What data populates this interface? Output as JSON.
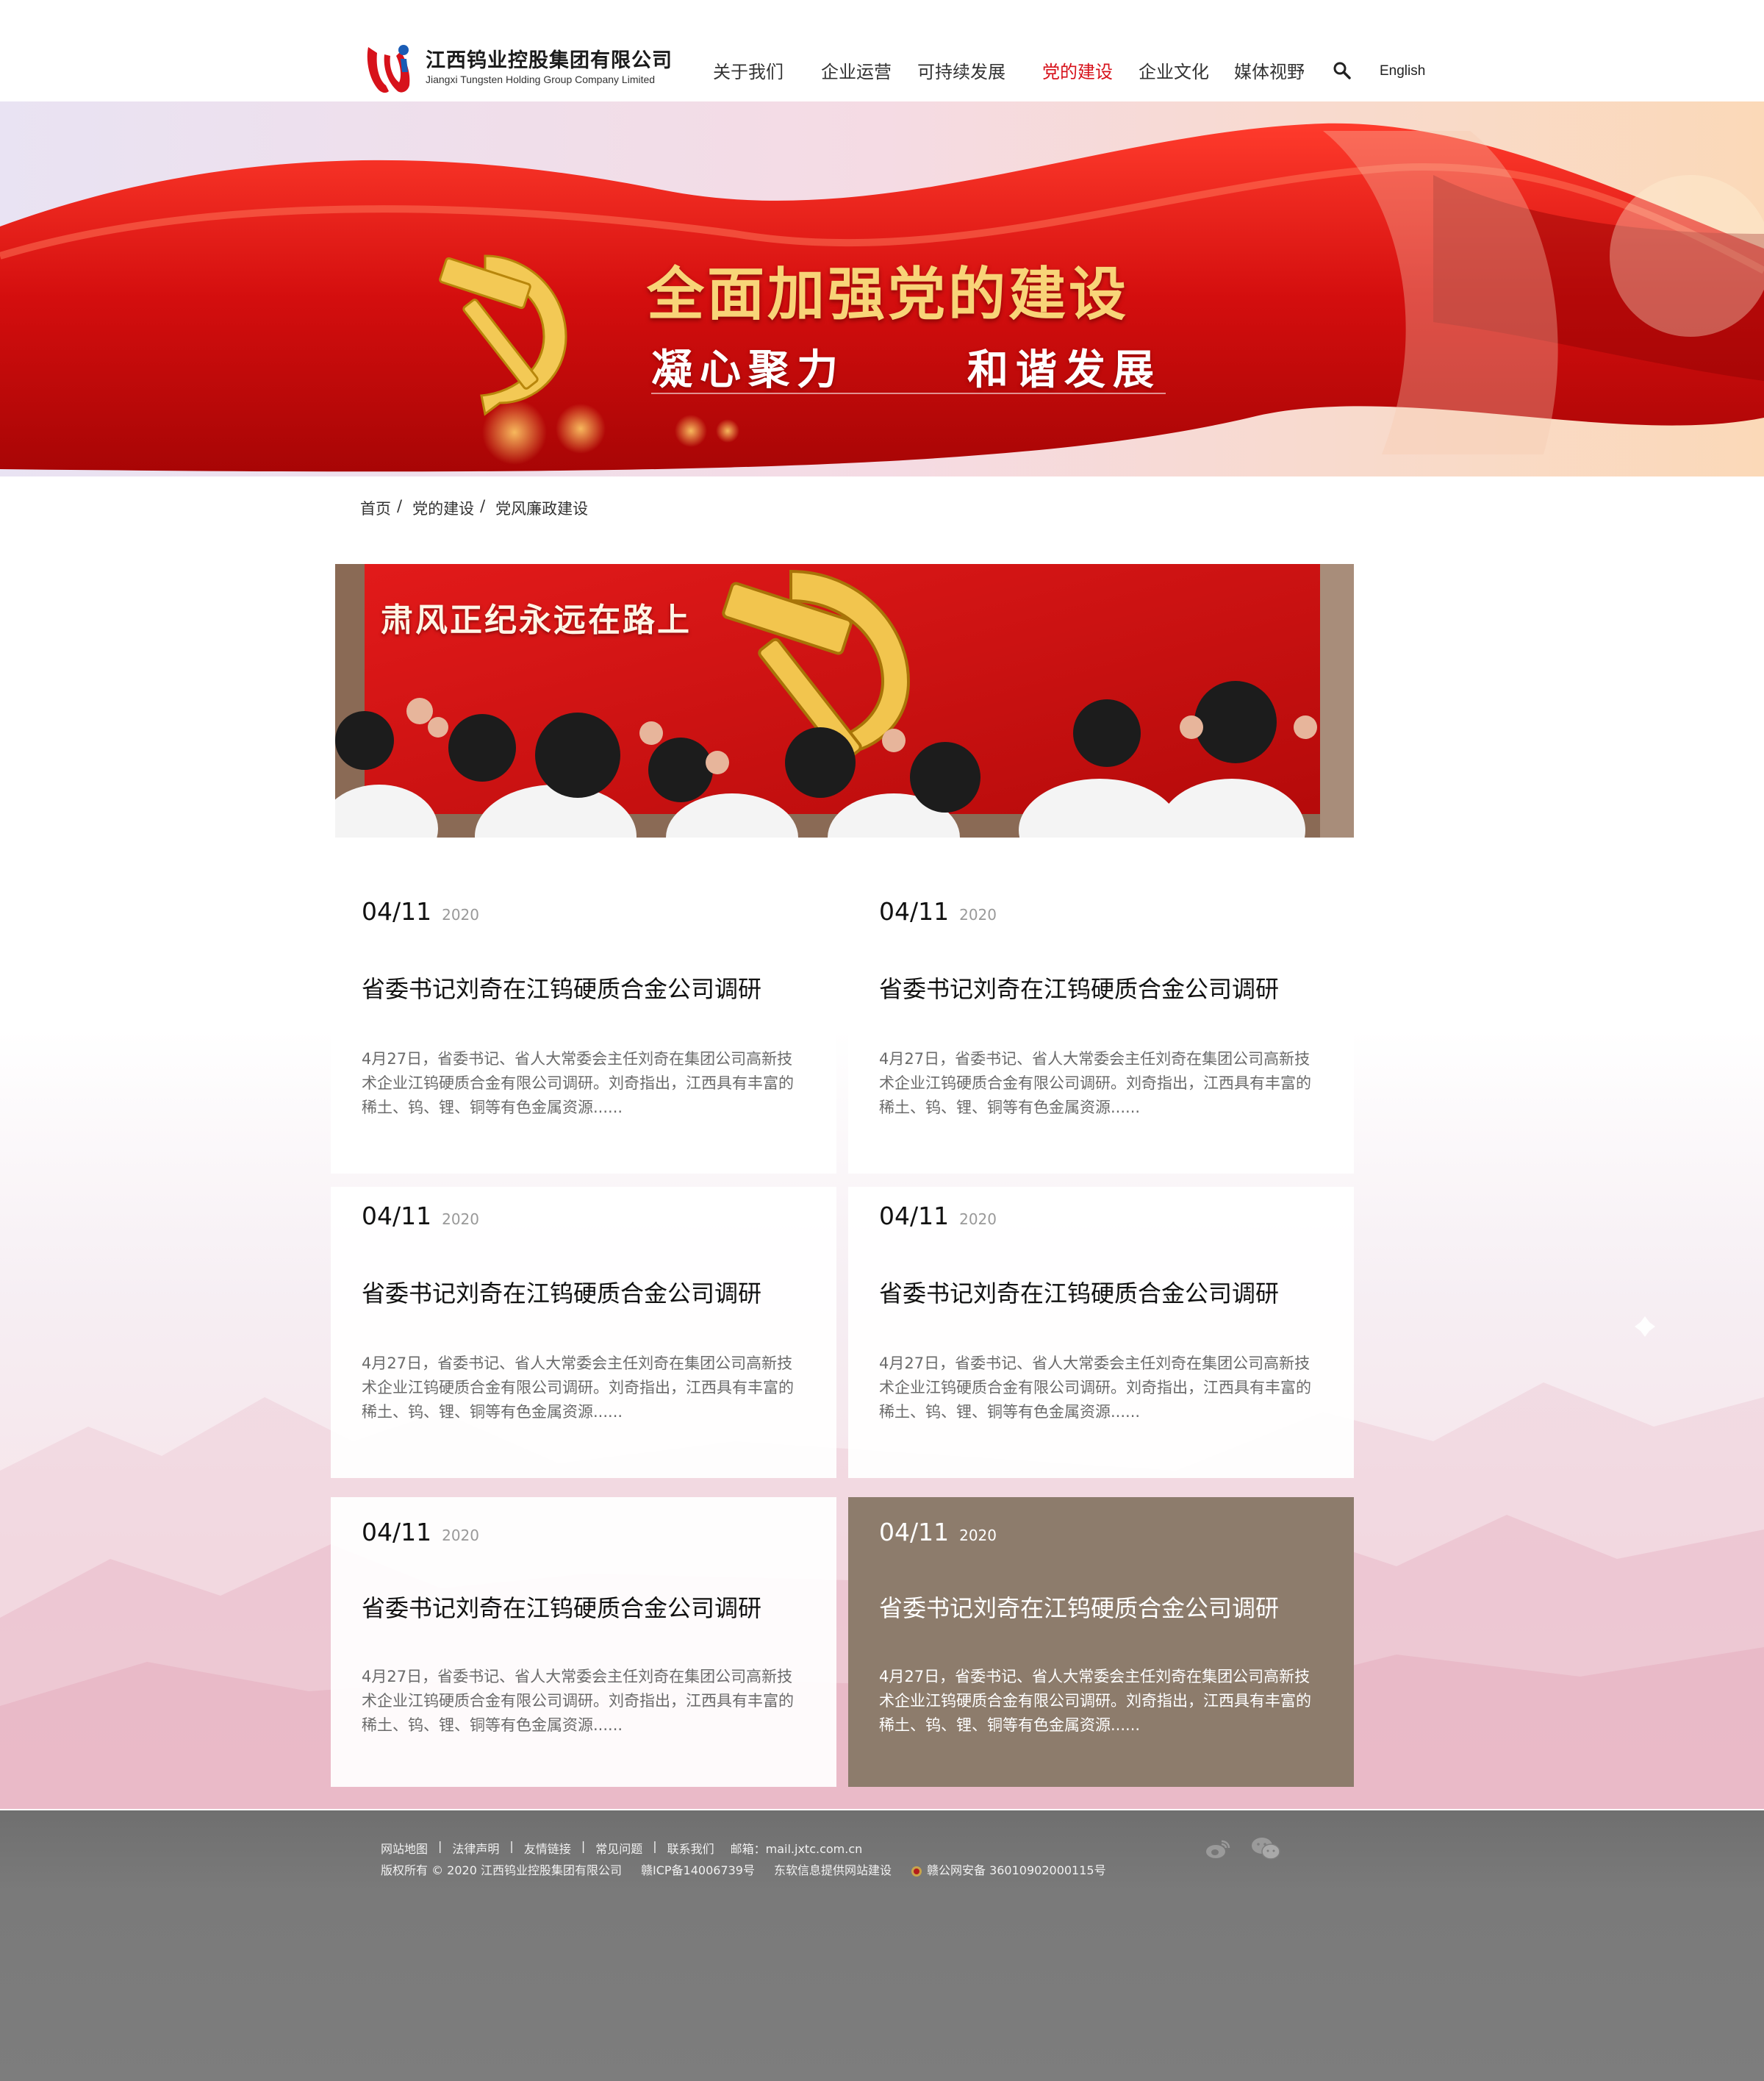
{
  "header": {
    "logo_cn": "江西钨业控股集团有限公司",
    "logo_en": "Jiangxi Tungsten Holding Group Company Limited",
    "nav": [
      "关于我们",
      "企业运营",
      "可持续发展",
      "党的建设",
      "企业文化",
      "媒体视野"
    ],
    "active_nav": "党的建设",
    "lang": "English",
    "accent_color": "#d7121b"
  },
  "hero": {
    "title": "全面加强党的建设",
    "sub_left": "凝心聚力",
    "sub_right": "和谐发展"
  },
  "breadcrumb": [
    "首页",
    "党的建设",
    "党风廉政建设"
  ],
  "breadcrumb_sep": "/",
  "feature": {
    "title": "肃风正纪永远在路上"
  },
  "news": [
    {
      "date": "04/11",
      "year": "2020",
      "title": "省委书记刘奇在江钨硬质合金公司调研",
      "excerpt": "4月27日，省委书记、省人大常委会主任刘奇在集团公司高新技术企业江钨硬质合金有限公司调研。刘奇指出，江西具有丰富的稀土、钨、锂、铜等有色金属资源......"
    },
    {
      "date": "04/11",
      "year": "2020",
      "title": "省委书记刘奇在江钨硬质合金公司调研",
      "excerpt": "4月27日，省委书记、省人大常委会主任刘奇在集团公司高新技术企业江钨硬质合金有限公司调研。刘奇指出，江西具有丰富的稀土、钨、锂、铜等有色金属资源......"
    },
    {
      "date": "04/11",
      "year": "2020",
      "title": "省委书记刘奇在江钨硬质合金公司调研",
      "excerpt": "4月27日，省委书记、省人大常委会主任刘奇在集团公司高新技术企业江钨硬质合金有限公司调研。刘奇指出，江西具有丰富的稀土、钨、锂、铜等有色金属资源......"
    },
    {
      "date": "04/11",
      "year": "2020",
      "title": "省委书记刘奇在江钨硬质合金公司调研",
      "excerpt": "4月27日，省委书记、省人大常委会主任刘奇在集团公司高新技术企业江钨硬质合金有限公司调研。刘奇指出，江西具有丰富的稀土、钨、锂、铜等有色金属资源......"
    },
    {
      "date": "04/11",
      "year": "2020",
      "title": "省委书记刘奇在江钨硬质合金公司调研",
      "excerpt": "4月27日，省委书记、省人大常委会主任刘奇在集团公司高新技术企业江钨硬质合金有限公司调研。刘奇指出，江西具有丰富的稀土、钨、锂、铜等有色金属资源......"
    },
    {
      "date": "04/11",
      "year": "2020",
      "title": "省委书记刘奇在江钨硬质合金公司调研",
      "excerpt": "4月27日，省委书记、省人大常委会主任刘奇在集团公司高新技术企业江钨硬质合金有限公司调研。刘奇指出，江西具有丰富的稀土、钨、锂、铜等有色金属资源......"
    }
  ],
  "active_card_color": "#8d7c6c",
  "footer": {
    "links": [
      "网站地图",
      "法律声明",
      "友情链接",
      "常见问题",
      "联系我们"
    ],
    "link_sep": "|",
    "email": "邮箱：mail.jxtc.com.cn",
    "copyright": "版权所有 © 2020 江西钨业控股集团有限公司",
    "icp": "赣ICP备14006739号",
    "provider": "东软信息提供网站建设",
    "police": "赣公网安备 36010902000115号"
  }
}
